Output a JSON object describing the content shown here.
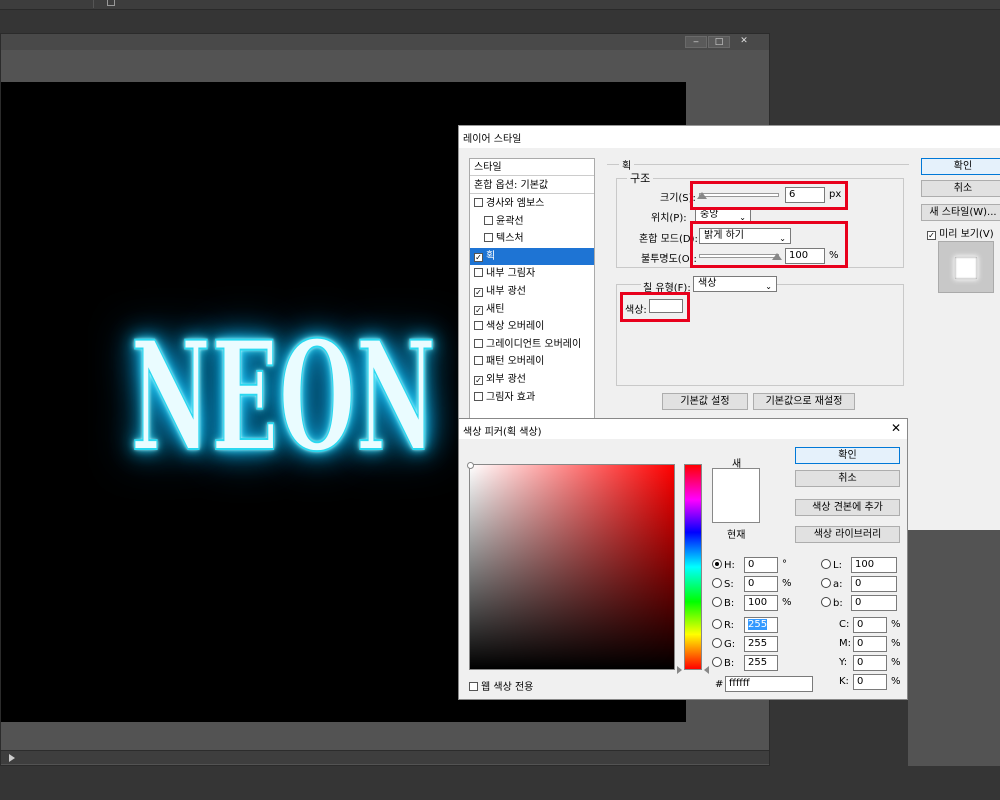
{
  "layer_style": {
    "title": "레이어 스타일",
    "styles_header": "스타일",
    "blend_options": "혼합 옵션: 기본값",
    "items": [
      {
        "label": "경사와 엠보스",
        "checked": false,
        "indent": false
      },
      {
        "label": "윤곽선",
        "checked": false,
        "indent": true
      },
      {
        "label": "텍스처",
        "checked": false,
        "indent": true
      },
      {
        "label": "획",
        "checked": true,
        "indent": false,
        "selected": true
      },
      {
        "label": "내부 그림자",
        "checked": false,
        "indent": false
      },
      {
        "label": "내부 광선",
        "checked": true,
        "indent": false
      },
      {
        "label": "새틴",
        "checked": true,
        "indent": false
      },
      {
        "label": "색상 오버레이",
        "checked": false,
        "indent": false
      },
      {
        "label": "그레이디언트 오버레이",
        "checked": false,
        "indent": false
      },
      {
        "label": "패턴 오버레이",
        "checked": false,
        "indent": false
      },
      {
        "label": "외부 광선",
        "checked": true,
        "indent": false
      },
      {
        "label": "그림자 효과",
        "checked": false,
        "indent": false
      }
    ],
    "section_title": "획",
    "structure_title": "구조",
    "size_label": "크기(S):",
    "size_value": "6",
    "size_unit": "px",
    "position_label": "위치(P):",
    "position_value": "중앙",
    "blend_mode_label": "혼합 모드(D):",
    "blend_mode_value": "밝게 하기",
    "opacity_label": "불투명도(O):",
    "opacity_value": "100",
    "opacity_unit": "%",
    "fill_type_label": "칠 유형(F):",
    "fill_type_value": "색상",
    "color_label": "색상:",
    "make_default": "기본값 설정",
    "reset_default": "기본값으로 재설정",
    "ok": "확인",
    "cancel": "취소",
    "new_style": "새 스타일(W)...",
    "preview_label": "미리 보기(V)",
    "preview_checked": true
  },
  "color_picker": {
    "title": "색상 피커(획 색상)",
    "new_label": "새",
    "current_label": "현재",
    "ok": "확인",
    "cancel": "취소",
    "add_swatch": "색상 견본에 추가",
    "color_libraries": "색상 라이브러리",
    "web_colors_only": "웹 색상 전용",
    "hex_prefix": "#",
    "hex": "ffffff",
    "hsb": [
      {
        "label": "H:",
        "value": "0",
        "unit": "°",
        "selected": true
      },
      {
        "label": "S:",
        "value": "0",
        "unit": "%",
        "selected": false
      },
      {
        "label": "B:",
        "value": "100",
        "unit": "%",
        "selected": false
      }
    ],
    "rgb": [
      {
        "label": "R:",
        "value": "255"
      },
      {
        "label": "G:",
        "value": "255"
      },
      {
        "label": "B:",
        "value": "255"
      }
    ],
    "lab": [
      {
        "label": "L:",
        "value": "100"
      },
      {
        "label": "a:",
        "value": "0"
      },
      {
        "label": "b:",
        "value": "0"
      }
    ],
    "cmyk": [
      {
        "label": "C:",
        "value": "0",
        "unit": "%"
      },
      {
        "label": "M:",
        "value": "0",
        "unit": "%"
      },
      {
        "label": "Y:",
        "value": "0",
        "unit": "%"
      },
      {
        "label": "K:",
        "value": "0",
        "unit": "%"
      }
    ],
    "new_color": "#ffffff"
  },
  "canvas": {
    "text": "NEON",
    "glow_color": "#17c8ff"
  },
  "window_controls": [
    "‒",
    "□",
    "✕"
  ],
  "accent_color": "#e8001c"
}
